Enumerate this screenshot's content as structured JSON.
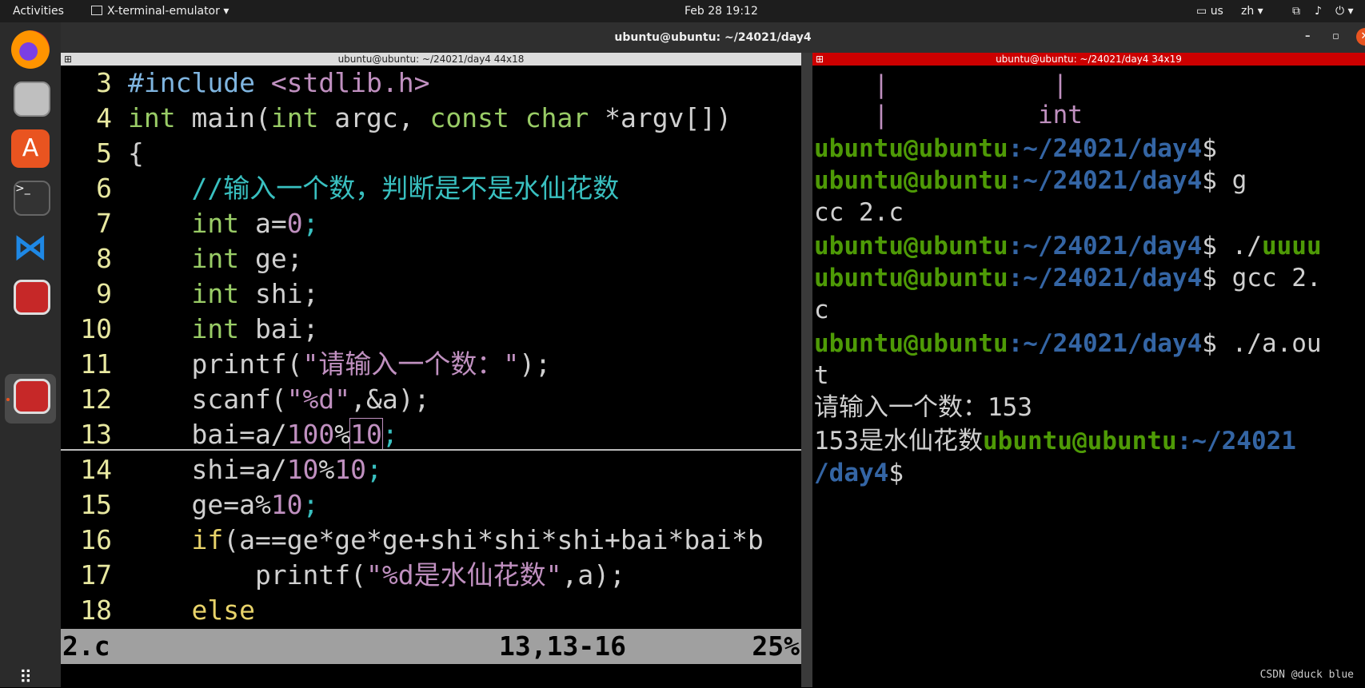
{
  "topbar": {
    "activities": "Activities",
    "app_menu": "X-terminal-emulator",
    "clock": "Feb 28  19:12",
    "keyboard": "us",
    "input_method": "zh"
  },
  "window": {
    "title": "ubuntu@ubuntu: ~/24021/day4"
  },
  "left_pane": {
    "header": "ubuntu@ubuntu: ~/24021/day4 44x18",
    "status": {
      "file": "2.c",
      "pos": "13,13-16",
      "percent": "25%"
    }
  },
  "right_pane": {
    "header": "ubuntu@ubuntu: ~/24021/day4 34x19",
    "prompt_user": "ubuntu@ubuntu",
    "prompt_path": ":~/24021/day4",
    "out_prompt": "请输入一个数：153",
    "out_result": "153是水仙花数",
    "lines": {
      "pipe1": "    |           |",
      "pipe2": "    |          int",
      "cmd_g": " g",
      "wrap_g": "cc 2.c",
      "cmd_run1a": " ./",
      "cmd_run1b": "uuuu",
      "cmd_gcc": " gcc 2.",
      "wrap_c": "c",
      "cmd_run2": " ./a.ou",
      "wrap_t": "t",
      "end_path_a": "~/24021",
      "end_path_b": "/day4",
      "dollar": "$"
    }
  },
  "code": {
    "l3": {
      "n": "3",
      "a": "#include ",
      "b": "<stdlib.h>"
    },
    "l4": {
      "n": "4",
      "a": "int",
      "b": " main(",
      "c": "int",
      "d": " argc, ",
      "e": "const",
      "f": " ",
      "g": "char",
      "h": " *argv[])"
    },
    "l5": {
      "n": "5",
      "a": "{"
    },
    "l6": {
      "n": "6",
      "a": "    //输入一个数，判断是不是水仙花数"
    },
    "l7": {
      "n": "7",
      "a": "    ",
      "b": "int",
      "c": " a=",
      "d": "0",
      "e": ";"
    },
    "l8": {
      "n": "8",
      "a": "    ",
      "b": "int",
      "c": " ge;"
    },
    "l9": {
      "n": "9",
      "a": "    ",
      "b": "int",
      "c": " shi;"
    },
    "l10": {
      "n": "10",
      "a": "    ",
      "b": "int",
      "c": " bai;"
    },
    "l11": {
      "n": "11",
      "a": "    printf(",
      "b": "\"请输入一个数：\"",
      "c": ");"
    },
    "l12": {
      "n": "12",
      "a": "    scanf(",
      "b": "\"%d\"",
      "c": ",&a);"
    },
    "l13": {
      "n": "13",
      "a": "    bai=a/",
      "b": "100",
      "c": "%",
      "d": "10",
      "e": ";"
    },
    "l14": {
      "n": "14",
      "a": "    shi=a/",
      "b": "10",
      "c": "%",
      "d": "10",
      "e": ";"
    },
    "l15": {
      "n": "15",
      "a": "    ge=a%",
      "b": "10",
      "c": ";"
    },
    "l16": {
      "n": "16",
      "a": "    ",
      "b": "if",
      "c": "(a==ge*ge*ge+shi*shi*shi+bai*bai*b"
    },
    "l17": {
      "n": "17",
      "a": "        printf(",
      "b": "\"%d是水仙花数\"",
      "c": ",a);"
    },
    "l18": {
      "n": "18",
      "a": "    ",
      "b": "else"
    }
  },
  "watermark": "CSDN @duck blue",
  "colors": {
    "prompt_user": "#4e9a06",
    "prompt_path": "#3465a4",
    "right_header": "#cc0000",
    "left_header": "#dcdcdc"
  }
}
